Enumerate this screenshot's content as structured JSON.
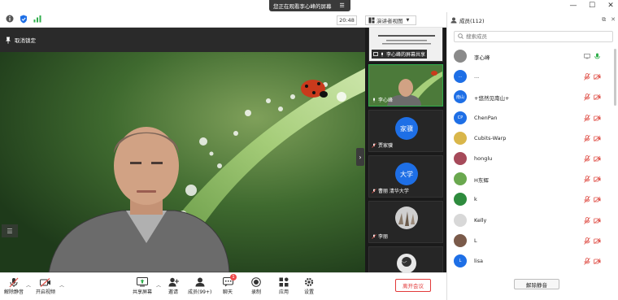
{
  "top": {
    "viewing_banner": "您正在观看李心峰的屏幕",
    "time": "20:48",
    "view_mode": "演讲者视图"
  },
  "main": {
    "unpin_label": "取消锁定"
  },
  "thumbnails": [
    {
      "name": "李心峰的屏幕共享",
      "type": "screen"
    },
    {
      "name": "李心峰",
      "type": "video"
    },
    {
      "name": "贾家骥",
      "type": "avatar",
      "avatar_text": "家骥"
    },
    {
      "name": "曹丽 清华大学",
      "type": "avatar",
      "avatar_text": "大学"
    },
    {
      "name": "李丽",
      "type": "photo"
    }
  ],
  "toolbar": {
    "unmute": "解除静音",
    "start_video": "开启视频",
    "share_screen": "共享屏幕",
    "invite": "邀请",
    "participants": "成员(99+)",
    "chat": "聊天",
    "chat_badge": "1",
    "record": "录制",
    "apps": "应用",
    "settings": "设置",
    "leave": "离开会议"
  },
  "panel": {
    "title": "成员(112)",
    "search_placeholder": "搜索成员",
    "unmute_all": "解除静音",
    "participants": [
      {
        "name": "李心峰",
        "avatar_color": "#8a8a8a",
        "avatar_text": "",
        "speaking": true
      },
      {
        "name": "...",
        "avatar_color": "#1e6fe6",
        "avatar_text": "…",
        "speaking": false
      },
      {
        "name": "+悠然见南山+",
        "avatar_color": "#1e6fe6",
        "avatar_text": "南山",
        "speaking": false
      },
      {
        "name": "ChenPan",
        "avatar_color": "#1e6fe6",
        "avatar_text": "CP",
        "speaking": false
      },
      {
        "name": "Cubits-Warp",
        "avatar_color": "#d9b64a",
        "avatar_text": "",
        "speaking": false
      },
      {
        "name": "honglu",
        "avatar_color": "#a64a5a",
        "avatar_text": "",
        "speaking": false
      },
      {
        "name": "H东辉",
        "avatar_color": "#6aa84f",
        "avatar_text": "",
        "speaking": false
      },
      {
        "name": "k",
        "avatar_color": "#2e8b3d",
        "avatar_text": "",
        "speaking": false
      },
      {
        "name": "Kelly",
        "avatar_color": "#d8d8d8",
        "avatar_text": "",
        "speaking": false
      },
      {
        "name": "L",
        "avatar_color": "#7a5a4a",
        "avatar_text": "",
        "speaking": false
      },
      {
        "name": "lisa",
        "avatar_color": "#1e6fe6",
        "avatar_text": "L",
        "speaking": false
      }
    ]
  },
  "colors": {
    "accent": "#1e6fe6",
    "leave": "#e23a3a",
    "muted_icon": "#e0554d"
  }
}
